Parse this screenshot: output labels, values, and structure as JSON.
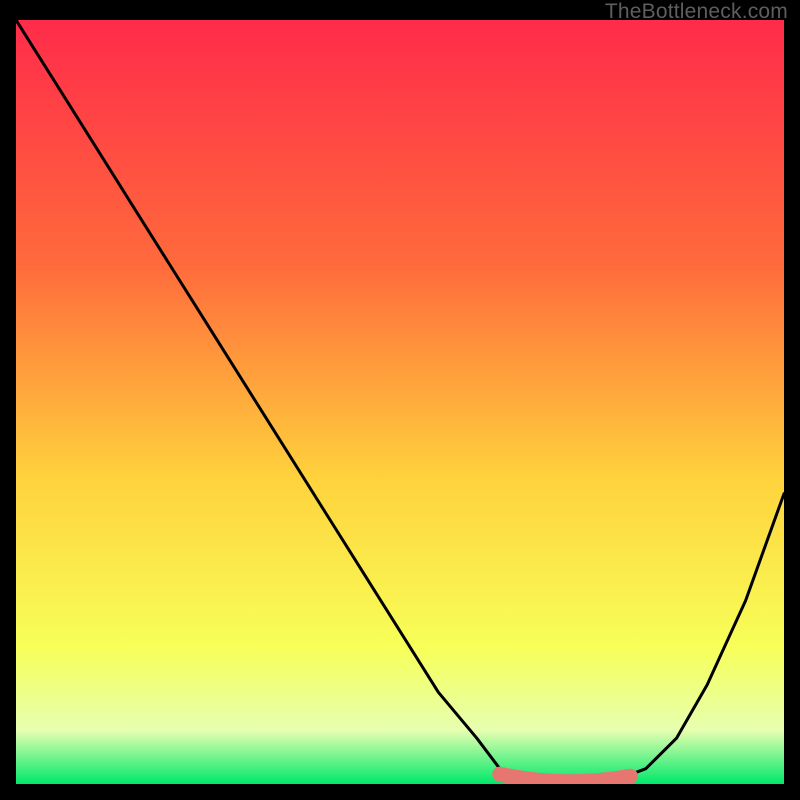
{
  "watermark": "TheBottleneck.com",
  "colors": {
    "background": "#000000",
    "gradient_top": "#ff2b4a",
    "gradient_mid1": "#ff6a3c",
    "gradient_mid2": "#ffd23c",
    "gradient_mid3": "#f7ff58",
    "gradient_bottom": "#00e86b",
    "curve": "#000000",
    "highlight": "#e77670"
  },
  "chart_data": {
    "type": "line",
    "title": "",
    "xlabel": "",
    "ylabel": "",
    "xlim": [
      0,
      100
    ],
    "ylim": [
      0,
      100
    ],
    "grid": false,
    "legend": false,
    "series": [
      {
        "name": "bottleneck-curve",
        "x": [
          0,
          5,
          10,
          15,
          20,
          25,
          30,
          35,
          40,
          45,
          50,
          55,
          60,
          63,
          66,
          70,
          74,
          78,
          82,
          86,
          90,
          95,
          100
        ],
        "y": [
          100,
          92,
          84,
          76,
          68,
          60,
          52,
          44,
          36,
          28,
          20,
          12,
          6,
          2,
          0.5,
          0,
          0,
          0.5,
          2,
          6,
          13,
          24,
          38
        ]
      }
    ],
    "highlight_segment": {
      "name": "optimal-range",
      "x_start": 63,
      "x_end": 80,
      "y": 0.5
    },
    "annotations": []
  }
}
